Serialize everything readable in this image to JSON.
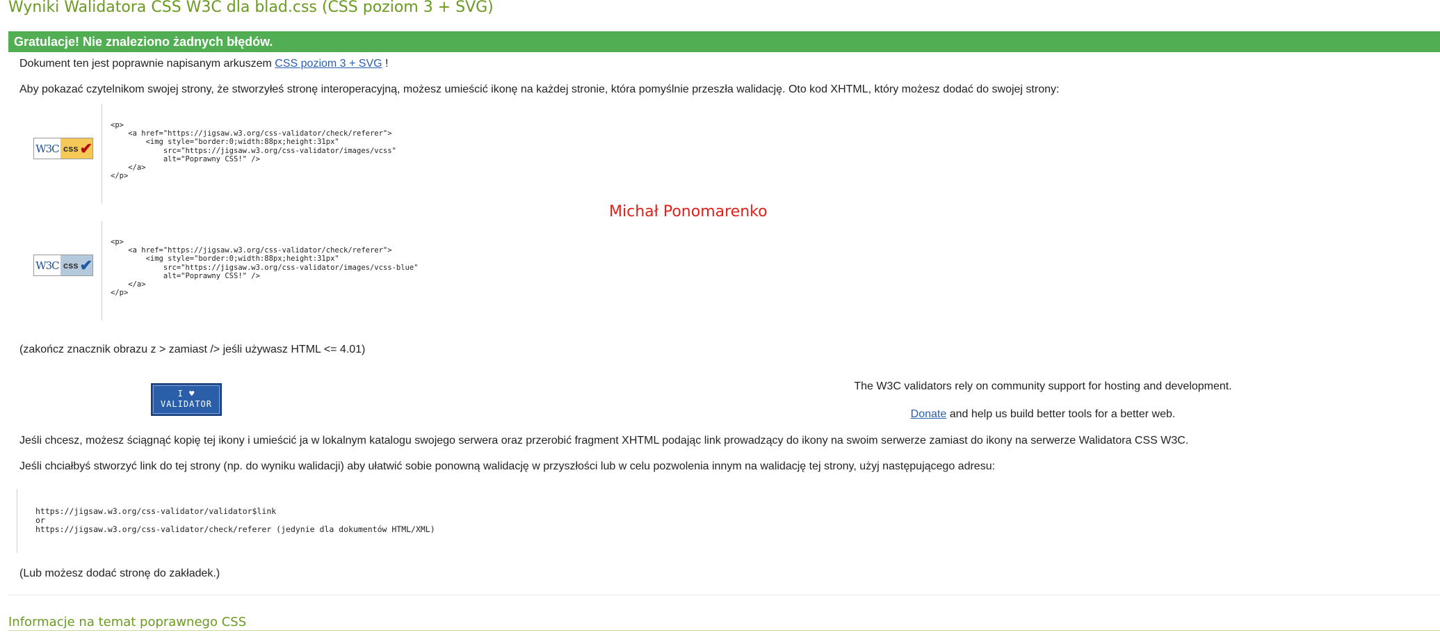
{
  "page_title": "Wyniki Walidatora CSS W3C dla blad.css (CSS poziom 3 + SVG)",
  "success_banner": "Gratulacje! Nie znaleziono żadnych błędów.",
  "valid_doc": {
    "prefix": "Dokument ten jest poprawnie napisanym arkuszem ",
    "link": "CSS poziom 3 + SVG",
    "suffix": " !"
  },
  "icon_intro": "Aby pokazać czytelnikom swojej strony, że stworzyłeś stronę interoperacyjną, możesz umieścić ikonę na każdej stronie, która pomyślnie przeszła walidację. Oto kod XHTML, który możesz dodać do swojej strony:",
  "badge_gold": {
    "w3c": "W3C",
    "css": "css",
    "check_icon": "red-checkmark-icon",
    "code": "<p>\n    <a href=\"https://jigsaw.w3.org/css-validator/check/referer\">\n        <img style=\"border:0;width:88px;height:31px\"\n            src=\"https://jigsaw.w3.org/css-validator/images/vcss\"\n            alt=\"Poprawny CSS!\" />\n    </a>\n</p>"
  },
  "watermark": "Michał Ponomarenko",
  "badge_blue": {
    "w3c": "W3C",
    "css": "css",
    "check_icon": "blue-checkmark-icon",
    "code": "<p>\n    <a href=\"https://jigsaw.w3.org/css-validator/check/referer\">\n        <img style=\"border:0;width:88px;height:31px\"\n            src=\"https://jigsaw.w3.org/css-validator/images/vcss-blue\"\n            alt=\"Poprawny CSS!\" />\n    </a>\n</p>"
  },
  "html_note": "(zakończ znacznik obrazu z > zamiast /> jeśli używasz HTML <= 4.01)",
  "validator_badge": {
    "line1": "I ♥",
    "line2": "VALIDATOR"
  },
  "community": {
    "line1": "The W3C validators rely on community support for hosting and development.",
    "donate": "Donate",
    "line2_rest": " and help us build better tools for a better web."
  },
  "download_note": "Jeśli chcesz, możesz ściągnąć kopię tej ikony i umieścić ja w lokalnym katalogu swojego serwera oraz przerobić fragment XHTML podając link prowadzący do ikony na swoim serwerze zamiast do ikony na serwerze Walidatora CSS W3C.",
  "link_note": "Jeśli chciałbyś stworzyć link do tej strony (np. do wyniku walidacji) aby ułatwić sobie ponowną walidację w przyszłości lub w celu pozwolenia innym na walidację tej strony, użyj następującego adresu:",
  "url_block": "https://jigsaw.w3.org/css-validator/validator$link\nor\nhttps://jigsaw.w3.org/css-validator/check/referer (jedynie dla dokumentów HTML/XML)",
  "bookmark_note": "(Lub możesz dodać stronę do zakładek.)",
  "section_title": "Informacje na temat poprawnego CSS",
  "colors": {
    "title_green": "#6a9a1f",
    "banner_green": "#52ae52",
    "link_blue": "#2a5db0",
    "watermark_red": "#e0201b"
  }
}
